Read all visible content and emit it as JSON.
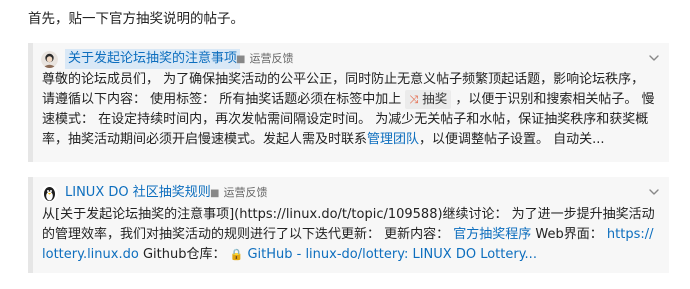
{
  "intro": "首先，贴一下官方抽奖说明的帖子。",
  "cards": [
    {
      "title": "关于发起论坛抽奖的注意事项",
      "category": "运营反馈",
      "body_1": "尊敬的论坛成员们， 为了确保抽奖活动的公平公正，同时防止无意义帖子频繁顶起话题，影响论坛秩序，请遵循以下内容： 使用标签： 所有抽奖话题必须在标签中加上 ",
      "tag": "抽奖",
      "body_2": " ，以便于识别和搜索相关帖子。 慢速模式： 在设定持续时间内，再次发帖需间隔设定时间。 为减少无关帖子和水帖，保证抽奖秩序和获奖概率，抽奖活动期间必须开启慢速模式。发起人需及时联系",
      "link": "管理团队",
      "body_3": "，以便调整帖子设置。 自动关..."
    },
    {
      "title": "LINUX DO 社区抽奖规则",
      "category": "运营反馈",
      "body_1": "从[关于发起论坛抽奖的注意事项](https://linux.do/t/topic/109588)继续讨论： 为了进一步提升抽奖活动的管理效率，我们对抽奖活动的规则进行了以下迭代更新： 更新内容： ",
      "link_1": "官方抽奖程序",
      "body_2": " Web界面： ",
      "link_2": "https://lottery.linux.do",
      "body_3": " Github仓库： ",
      "link_3": "GitHub - linux-do/lottery: LINUX DO Lottery..."
    }
  ]
}
